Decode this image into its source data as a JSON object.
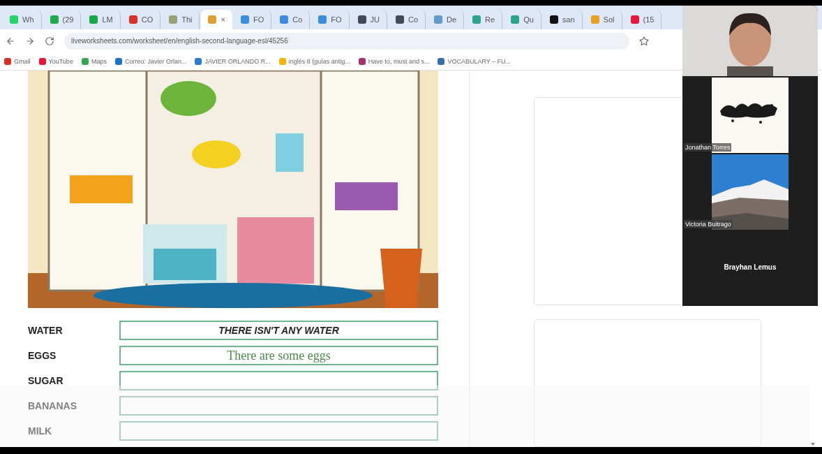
{
  "browser": {
    "tabs": [
      {
        "label": "Wh",
        "color": "#25d366",
        "selected": false
      },
      {
        "label": "(29",
        "color": "#1fa94b",
        "selected": false
      },
      {
        "label": "LM",
        "color": "#18a84a",
        "selected": false
      },
      {
        "label": "CO",
        "color": "#d93025",
        "selected": false
      },
      {
        "label": "Thi",
        "color": "#9aa07a",
        "selected": false
      },
      {
        "label": "×",
        "color": "#e0a030",
        "selected": true
      },
      {
        "label": "FO",
        "color": "#3b8be0",
        "selected": false
      },
      {
        "label": "Co",
        "color": "#3b8be0",
        "selected": false
      },
      {
        "label": "FO",
        "color": "#3b8be0",
        "selected": false
      },
      {
        "label": "JU",
        "color": "#444a55",
        "selected": false
      },
      {
        "label": "Co",
        "color": "#444a55",
        "selected": false
      },
      {
        "label": "De",
        "color": "#5f9bd0",
        "selected": false
      },
      {
        "label": "Re",
        "color": "#2aa38a",
        "selected": false
      },
      {
        "label": "Qu",
        "color": "#2aa38a",
        "selected": false
      },
      {
        "label": "san",
        "color": "#111111",
        "selected": false
      },
      {
        "label": "Sol",
        "color": "#e8a020",
        "selected": false
      },
      {
        "label": "(15",
        "color": "#e8173a",
        "selected": false
      }
    ],
    "address": "liveworksheets.com/worksheet/en/english-second-language-esl/45256",
    "bookmarks": [
      {
        "label": "Gmail",
        "color": "#d93025"
      },
      {
        "label": "YouTube",
        "color": "#e8173a"
      },
      {
        "label": "Maps",
        "color": "#34a853"
      },
      {
        "label": "Correo: Javier Orlan...",
        "color": "#1a73c8"
      },
      {
        "label": "JAVIER ORLANDO R...",
        "color": "#2a7ad0"
      },
      {
        "label": "inglés 8 (guías antig...",
        "color": "#f2b400"
      },
      {
        "label": "Have to, must and s...",
        "color": "#a8336a"
      },
      {
        "label": "VOCABULARY – FU...",
        "color": "#3a6ea8"
      }
    ]
  },
  "worksheet": {
    "rows": [
      {
        "label": "WATER",
        "value": "THERE ISN'T ANY WATER",
        "kind": "typed"
      },
      {
        "label": "EGGS",
        "value": "There are some eggs",
        "kind": "handwritten"
      },
      {
        "label": "SUGAR"
      },
      {
        "label": "BANANAS"
      },
      {
        "label": "MILK"
      }
    ]
  },
  "call": {
    "participants": [
      {
        "kind": "camera"
      },
      {
        "kind": "picture",
        "name": "Jonathan Torres"
      },
      {
        "kind": "picture",
        "name": "Victoria Buitrago"
      },
      {
        "kind": "name-only",
        "name": "Brayhan Lemus"
      }
    ]
  }
}
